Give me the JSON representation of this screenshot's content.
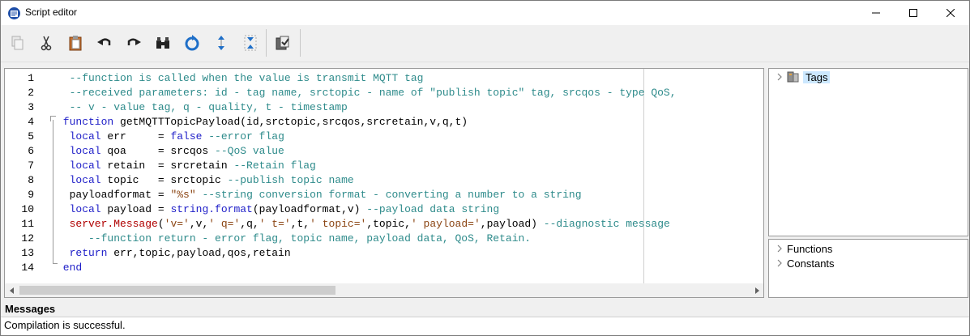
{
  "window": {
    "title": "Script editor"
  },
  "toolbar": {
    "buttons": [
      "copy-icon",
      "cut-icon",
      "paste-icon",
      "undo-icon",
      "redo-icon",
      "find-icon",
      "refresh-icon",
      "expand-icon",
      "collapse-icon",
      "compile-icon"
    ]
  },
  "editor": {
    "line_numbers": [
      "1",
      "2",
      "3",
      "4",
      "5",
      "6",
      "7",
      "8",
      "9",
      "10",
      "11",
      "12",
      "13",
      "14"
    ],
    "lines": [
      [
        {
          "c": "cm",
          "t": "  --function is called when the value is transmit MQTT tag"
        }
      ],
      [
        {
          "c": "cm",
          "t": "  --received parameters: id - tag name, srctopic - name of \"publish topic\" tag, srcqos - type QoS,"
        }
      ],
      [
        {
          "c": "cm",
          "t": "  -- v - value tag, q - quality, t - timestamp"
        }
      ],
      [
        {
          "c": "kw",
          "t": " function"
        },
        {
          "c": "tx",
          "t": " getMQTTTopicPayload(id,srctopic,srcqos,srcretain,v,q,t)"
        }
      ],
      [
        {
          "c": "kw",
          "t": "  local"
        },
        {
          "c": "tx",
          "t": " err     = "
        },
        {
          "c": "kw",
          "t": "false"
        },
        {
          "c": "cm",
          "t": " --error flag"
        }
      ],
      [
        {
          "c": "kw",
          "t": "  local"
        },
        {
          "c": "tx",
          "t": " qoa     = srcqos "
        },
        {
          "c": "cm",
          "t": "--QoS value"
        }
      ],
      [
        {
          "c": "kw",
          "t": "  local"
        },
        {
          "c": "tx",
          "t": " retain  = srcretain "
        },
        {
          "c": "cm",
          "t": "--Retain flag"
        }
      ],
      [
        {
          "c": "kw",
          "t": "  local"
        },
        {
          "c": "tx",
          "t": " topic   = srctopic "
        },
        {
          "c": "cm",
          "t": "--publish topic name"
        }
      ],
      [
        {
          "c": "tx",
          "t": "  payloadformat = "
        },
        {
          "c": "st",
          "t": "\"%s\""
        },
        {
          "c": "cm",
          "t": " --string conversion format - converting a number to a string"
        }
      ],
      [
        {
          "c": "kw",
          "t": "  local"
        },
        {
          "c": "tx",
          "t": " payload = "
        },
        {
          "c": "kw",
          "t": "string.format"
        },
        {
          "c": "tx",
          "t": "(payloadformat,v) "
        },
        {
          "c": "cm",
          "t": "--payload data string"
        }
      ],
      [
        {
          "c": "fn",
          "t": "  server.Message"
        },
        {
          "c": "tx",
          "t": "("
        },
        {
          "c": "st",
          "t": "'v='"
        },
        {
          "c": "tx",
          "t": ",v,"
        },
        {
          "c": "st",
          "t": "' q='"
        },
        {
          "c": "tx",
          "t": ",q,"
        },
        {
          "c": "st",
          "t": "' t='"
        },
        {
          "c": "tx",
          "t": ",t,"
        },
        {
          "c": "st",
          "t": "' topic='"
        },
        {
          "c": "tx",
          "t": ",topic,"
        },
        {
          "c": "st",
          "t": "' payload='"
        },
        {
          "c": "tx",
          "t": ",payload) "
        },
        {
          "c": "cm",
          "t": "--diagnostic message"
        }
      ],
      [
        {
          "c": "cm",
          "t": "     --function return - error flag, topic name, payload data, QoS, Retain."
        }
      ],
      [
        {
          "c": "kw",
          "t": "  return"
        },
        {
          "c": "tx",
          "t": " err,topic,payload,qos,retain"
        }
      ],
      [
        {
          "c": "kw",
          "t": " end"
        }
      ]
    ]
  },
  "tags_panel": {
    "root_label": "Tags"
  },
  "functions_panel": {
    "items": [
      "Functions",
      "Constants"
    ]
  },
  "messages": {
    "header": "Messages",
    "text": "Compilation is successful."
  }
}
